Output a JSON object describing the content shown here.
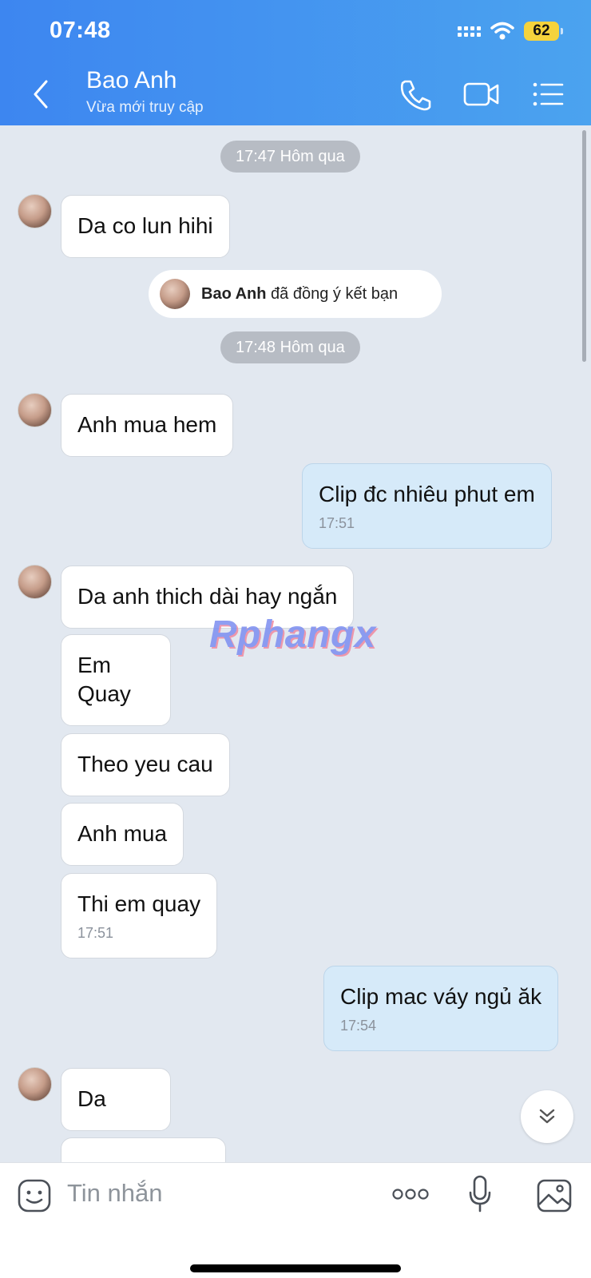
{
  "status_bar": {
    "time": "07:48",
    "battery": "62"
  },
  "header": {
    "contact_name": "Bao Anh",
    "contact_status": "Vừa mới truy cập"
  },
  "chat": {
    "time_separator_1": "17:47 Hôm qua",
    "time_separator_2": "17:48 Hôm qua",
    "system_event": {
      "name": "Bao Anh",
      "text": "đã đồng ý kết bạn"
    },
    "messages": [
      {
        "from": "contact",
        "text": "Da co lun hihi"
      },
      {
        "from": "contact",
        "text": "Anh mua hem"
      },
      {
        "from": "me",
        "text": "Clip đc nhiêu phut em",
        "time": "17:51"
      },
      {
        "from": "contact",
        "text": "Da anh thich dài hay ngắn"
      },
      {
        "from": "contact",
        "text": "Em Quay"
      },
      {
        "from": "contact",
        "text": "Theo yeu cau"
      },
      {
        "from": "contact",
        "text": "Anh mua"
      },
      {
        "from": "contact",
        "text": "Thi em quay",
        "time": "17:51"
      },
      {
        "from": "me",
        "text": "Clip mac váy ngủ ăk",
        "time": "17:54"
      },
      {
        "from": "contact",
        "text": "Da"
      }
    ],
    "watermark": "Rphangx"
  },
  "input": {
    "placeholder": "Tin nhắn"
  },
  "colors": {
    "header_gradient_start": "#3d86f0",
    "header_gradient_end": "#4ba3ef",
    "my_bubble": "#d6eaf9",
    "chat_bg": "#e2e8f0"
  }
}
